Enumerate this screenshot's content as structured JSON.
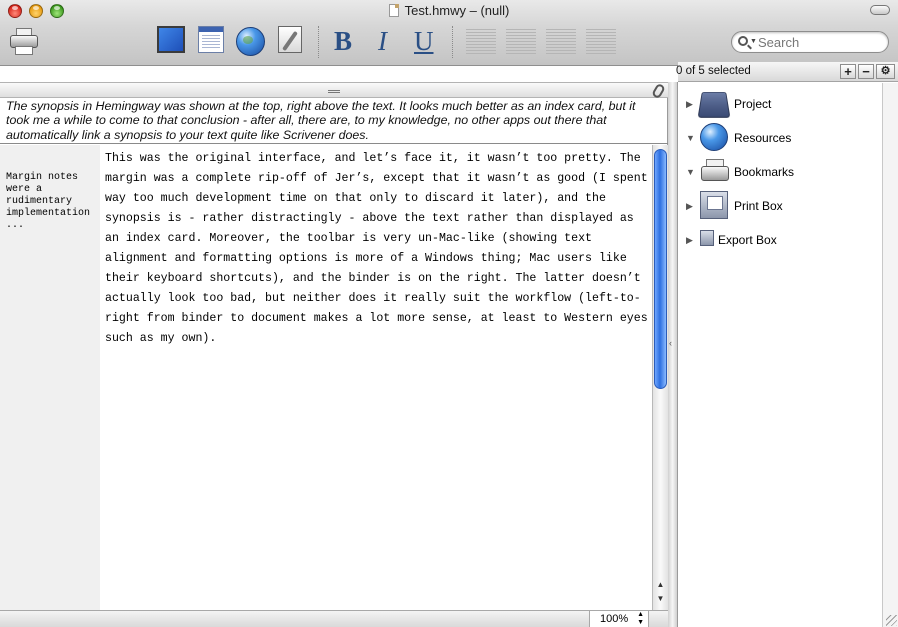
{
  "window": {
    "title": "Test.hmwy – (null)"
  },
  "toolbar": {
    "items": [
      {
        "name": "printer-icon",
        "type": "icon"
      },
      {
        "name": "fullscreen-icon",
        "type": "icon"
      },
      {
        "name": "notecard-icon",
        "type": "icon"
      },
      {
        "name": "globe-icon",
        "type": "icon"
      },
      {
        "name": "snapshot-icon",
        "type": "icon"
      }
    ],
    "format": {
      "bold": "B",
      "italic": "I",
      "underline": "U"
    },
    "search": {
      "placeholder": "Search",
      "value": ""
    }
  },
  "editor": {
    "synopsis": "The synopsis in Hemingway was shown at the top, right above the text. It looks much better as an index card, but it took me a while to come to that conclusion - after all, there are, to my knowledge, no other apps out there that automatically link a synopsis to your text quite like Scrivener does.",
    "margin_note": "Margin notes were a rudimentary implementation ...",
    "body": "This was the original interface, and let’s face it, it wasn’t too pretty. The margin was a complete rip-off of Jer’s, except that it wasn’t as good (I spent way too much development time on that only to discard it later), and the synopsis is - rather distractingly - above the text rather than displayed as an index card. Moreover, the toolbar is very un-Mac-like (showing text alignment and formatting options is more of a Windows thing; Mac users like their keyboard shortcuts), and the binder is on the right. The latter doesn’t actually look too bad, but neither does it really suit the workflow (left-to-right from binder to document makes a lot more sense, at least to Western eyes such as my own).",
    "zoom": "100%"
  },
  "binder": {
    "selection_status": "0 of 5 selected",
    "items": [
      {
        "label": "Project",
        "disclosure": "collapsed",
        "icon": "project-icon"
      },
      {
        "label": "Resources",
        "disclosure": "expanded",
        "icon": "globe-icon"
      },
      {
        "label": "Bookmarks",
        "disclosure": "expanded",
        "icon": "printer-icon"
      },
      {
        "label": "Print Box",
        "disclosure": "collapsed",
        "icon": "print-box-icon"
      },
      {
        "label": "Export Box",
        "disclosure": "collapsed",
        "icon": "export-box-icon"
      }
    ]
  }
}
